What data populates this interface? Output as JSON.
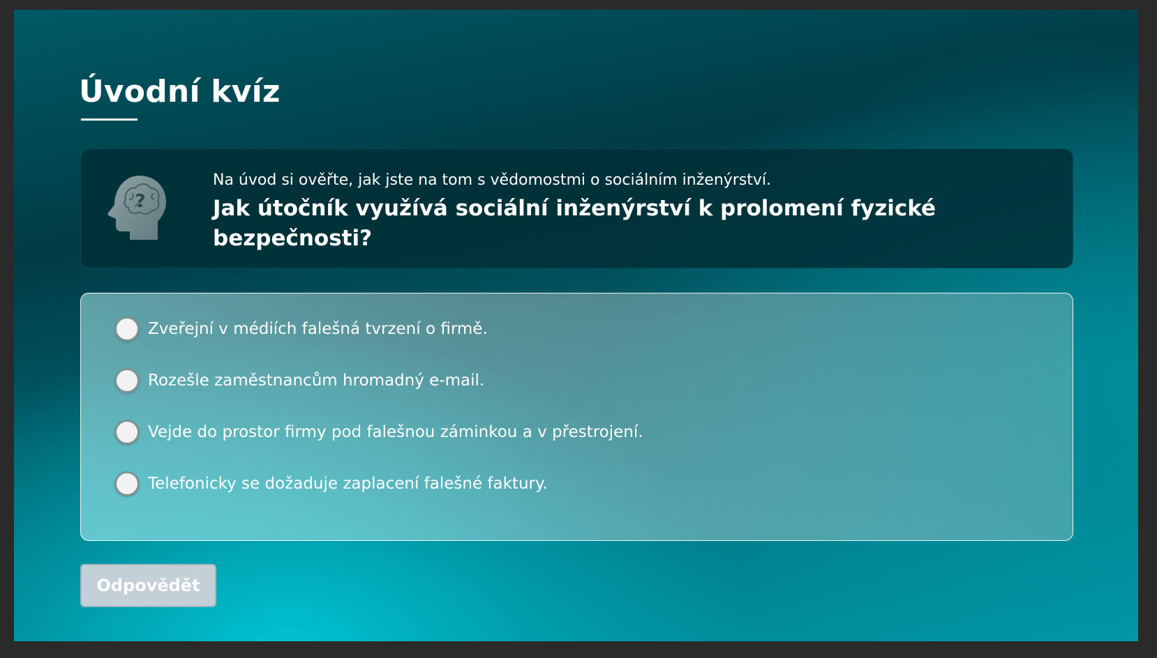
{
  "quiz": {
    "title": "Úvodní kvíz",
    "intro": "Na úvod si ověřte, jak jste na tom s vědomostmi o sociálním inženýrství.",
    "question": "Jak útočník využívá sociální inženýrství k prolomení fyzické bezpečnosti?",
    "question_icon": "head-question-icon",
    "options": [
      {
        "label": "Zveřejní v médiích falešná tvrzení o firmě.",
        "selected": false
      },
      {
        "label": "Rozešle zaměstnancům hromadný e-mail.",
        "selected": false
      },
      {
        "label": "Vejde do prostor firmy pod falešnou záminkou a v přestrojení.",
        "selected": false
      },
      {
        "label": "Telefonicky se dožaduje zaplacení falešné faktury.",
        "selected": false
      }
    ],
    "submit_label": "Odpovědět",
    "submit_enabled": false
  },
  "colors": {
    "accent": "#00a9b5",
    "dark_panel": "#00313a",
    "button_disabled": "#c3d0d8"
  }
}
